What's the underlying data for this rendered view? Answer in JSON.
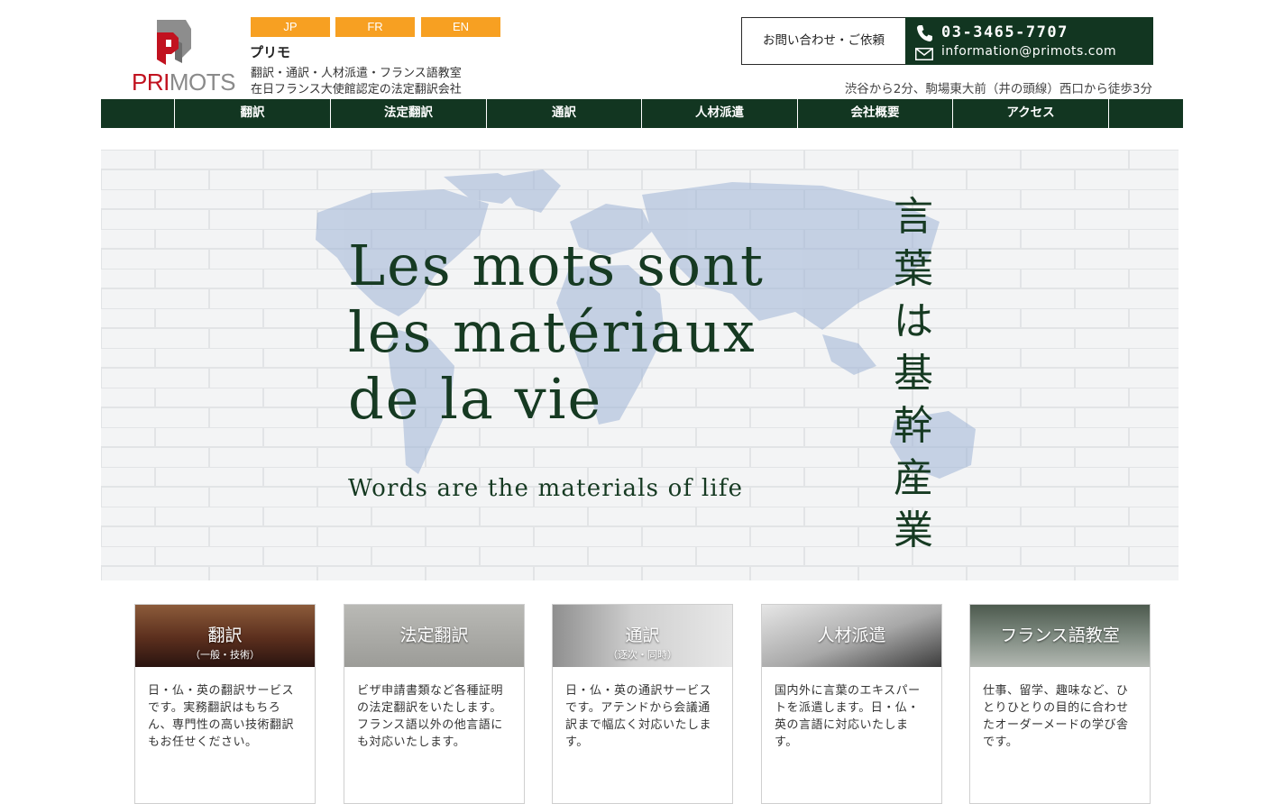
{
  "header": {
    "logo_text_a": "PRI",
    "logo_text_b": "MOTS",
    "brand_name": "プリモ",
    "tagline_1": "翻訳・通訳・人材派遣・フランス語教室",
    "tagline_2": "在日フランス大使館認定の法定翻訳会社",
    "languages": [
      "JP",
      "FR",
      "EN"
    ],
    "contact_label": "お問い合わせ・ご依頼",
    "phone": "03-3465-7707",
    "email": "information@primots.com",
    "access_note": "渋谷から2分、駒場東大前（井の頭線）西口から徒歩3分"
  },
  "nav": {
    "items": [
      "翻訳",
      "法定翻訳",
      "通訳",
      "人材派遣",
      "会社概要",
      "アクセス"
    ]
  },
  "hero": {
    "line_1": "Les mots sont",
    "line_2": "les matériaux",
    "line_3": "de la vie",
    "subtitle": "Words are the materials of life",
    "vertical": [
      "言",
      "葉",
      "は",
      "基",
      "幹",
      "産",
      "業"
    ]
  },
  "cards": [
    {
      "title": "翻訳",
      "subtitle": "（一般・技術）",
      "text": "日・仏・英の翻訳サービスです。実務翻訳はもちろん、専門性の高い技術翻訳もお任せください。"
    },
    {
      "title": "法定翻訳",
      "subtitle": "",
      "text": "ビザ申請書類など各種証明の法定翻訳をいたします。フランス語以外の他言語にも対応いたします。"
    },
    {
      "title": "通訳",
      "subtitle": "（逐次・同時）",
      "text": "日・仏・英の通訳サービスです。アテンドから会議通訳まで幅広く対応いたします。"
    },
    {
      "title": "人材派遣",
      "subtitle": "",
      "text": "国内外に言葉のエキスパートを派遣します。日・仏・英の言語に対応いたします。"
    },
    {
      "title": "フランス語教室",
      "subtitle": "",
      "text": "仕事、留学、趣味など、ひとりひとりの目的に合わせたオーダーメードの学び舎です。"
    }
  ],
  "colors": {
    "dark_green": "#123621",
    "orange": "#f7a022",
    "logo_red": "#c1121f"
  }
}
